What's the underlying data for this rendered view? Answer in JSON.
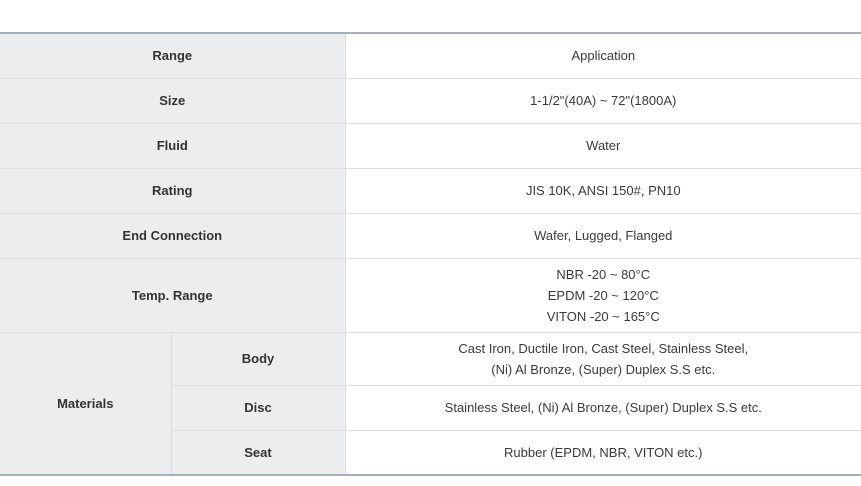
{
  "spec": {
    "range": {
      "label": "Range",
      "value": "Application"
    },
    "size": {
      "label": "Size",
      "value": "1-1/2\"(40A) ~ 72\"(1800A)"
    },
    "fluid": {
      "label": "Fluid",
      "value": "Water"
    },
    "rating": {
      "label": "Rating",
      "value": "JIS 10K, ANSI 150#, PN10"
    },
    "end_connection": {
      "label": "End Connection",
      "value": "Wafer, Lugged, Flanged"
    },
    "temp_range": {
      "label": "Temp. Range",
      "lines": [
        "NBR -20 ~ 80°C",
        "EPDM -20 ~ 120°C",
        "VITON -20 ~ 165°C"
      ]
    },
    "materials": {
      "label": "Materials",
      "body": {
        "label": "Body",
        "lines": [
          "Cast Iron, Ductile Iron, Cast Steel, Stainless Steel,",
          "(Ni) Al Bronze, (Super) Duplex S.S etc."
        ]
      },
      "disc": {
        "label": "Disc",
        "value": "Stainless Steel, (Ni) Al Bronze, (Super) Duplex S.S etc."
      },
      "seat": {
        "label": "Seat",
        "value": "Rubber (EPDM, NBR, VITON etc.)"
      }
    }
  }
}
